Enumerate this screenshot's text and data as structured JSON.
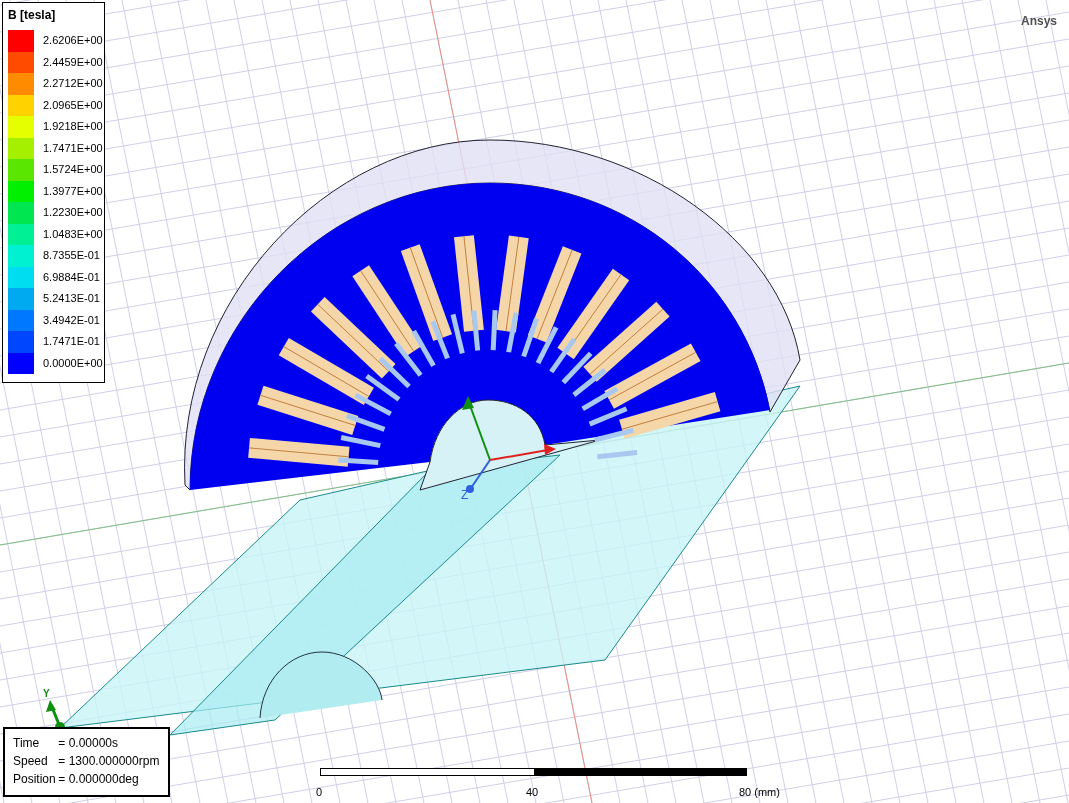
{
  "legend": {
    "title": "B [tesla]",
    "entries": [
      {
        "label": "2.6206E+00",
        "color": "#ff0000"
      },
      {
        "label": "2.4459E+00",
        "color": "#ff4b00"
      },
      {
        "label": "2.2712E+00",
        "color": "#ff8c00"
      },
      {
        "label": "2.0965E+00",
        "color": "#ffd200"
      },
      {
        "label": "1.9218E+00",
        "color": "#e6ff00"
      },
      {
        "label": "1.7471E+00",
        "color": "#a5f000"
      },
      {
        "label": "1.5724E+00",
        "color": "#5ae600"
      },
      {
        "label": "1.3977E+00",
        "color": "#00f000"
      },
      {
        "label": "1.2230E+00",
        "color": "#00e650"
      },
      {
        "label": "1.0483E+00",
        "color": "#00f096"
      },
      {
        "label": "8.7355E-01",
        "color": "#00f0d2"
      },
      {
        "label": "6.9884E-01",
        "color": "#00dcf0"
      },
      {
        "label": "5.2413E-01",
        "color": "#00aaf0"
      },
      {
        "label": "3.4942E-01",
        "color": "#0078ff"
      },
      {
        "label": "1.7471E-01",
        "color": "#0046ff"
      },
      {
        "label": "0.0000E+00",
        "color": "#0000ff"
      }
    ]
  },
  "brand": "Ansys",
  "triad": {
    "y_label": "Y",
    "z_label": "Z"
  },
  "info": [
    {
      "label": "Time",
      "value": "= 0.00000s"
    },
    {
      "label": "Speed",
      "value": "= 1300.000000rpm"
    },
    {
      "label": "Position",
      "value": "= 0.000000deg"
    }
  ],
  "scale_bar": {
    "ticks": [
      "0",
      "40",
      "80 (mm)"
    ]
  }
}
